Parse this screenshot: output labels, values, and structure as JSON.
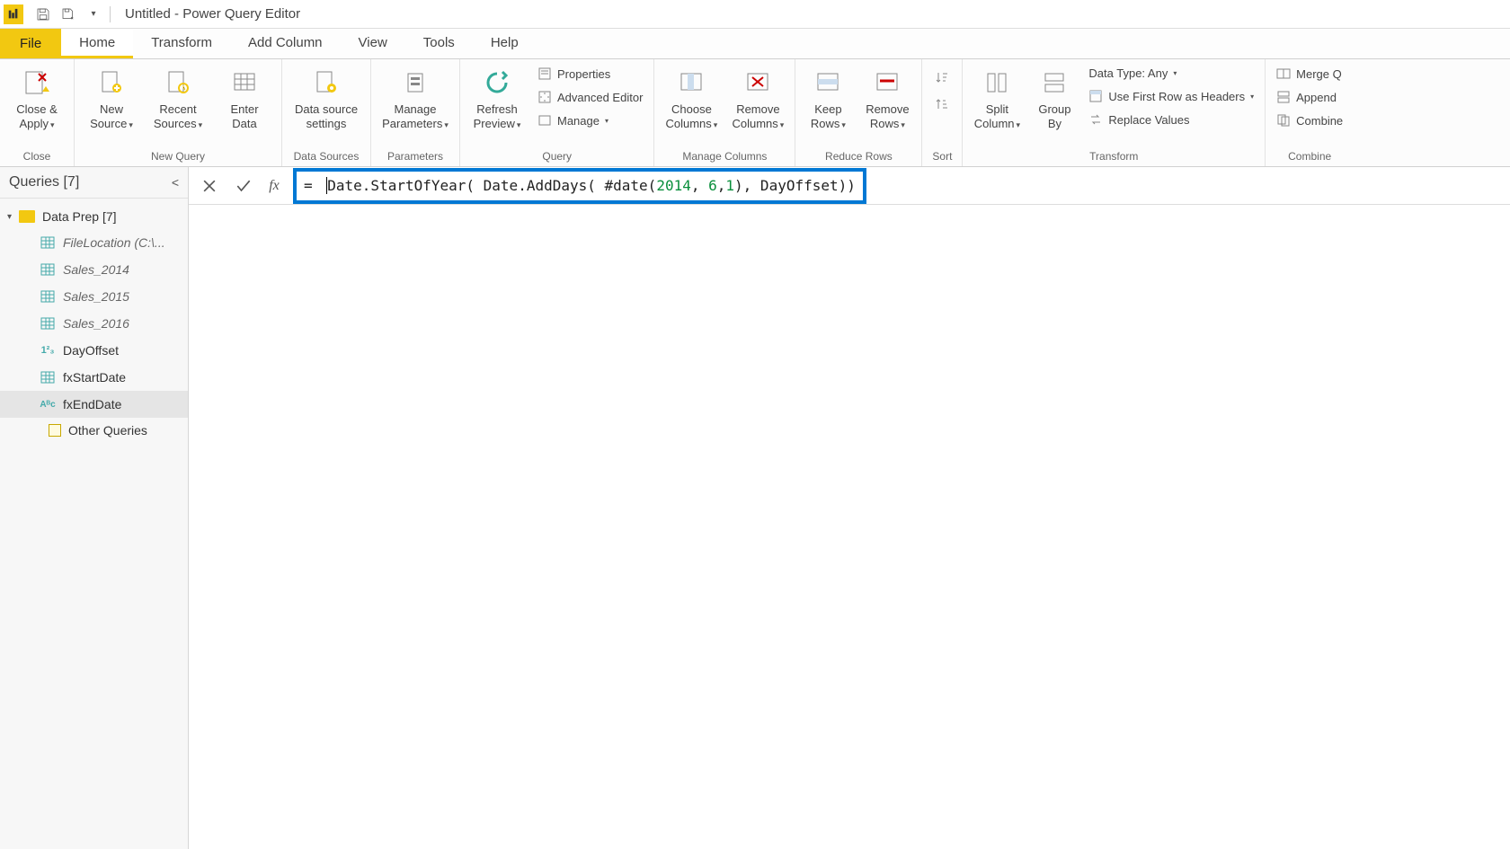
{
  "window": {
    "title": "Untitled - Power Query Editor"
  },
  "tabs": {
    "file": "File",
    "home": "Home",
    "transform": "Transform",
    "addColumn": "Add Column",
    "view": "View",
    "tools": "Tools",
    "help": "Help"
  },
  "ribbon": {
    "close": {
      "closeApply": "Close &\nApply",
      "group": "Close"
    },
    "newQuery": {
      "newSource": "New\nSource",
      "recentSources": "Recent\nSources",
      "enterData": "Enter\nData",
      "group": "New Query"
    },
    "dataSources": {
      "dataSourceSettings": "Data source\nsettings",
      "group": "Data Sources"
    },
    "parameters": {
      "manageParameters": "Manage\nParameters",
      "group": "Parameters"
    },
    "query": {
      "refreshPreview": "Refresh\nPreview",
      "properties": "Properties",
      "advancedEditor": "Advanced Editor",
      "manage": "Manage",
      "group": "Query"
    },
    "manageColumns": {
      "choose": "Choose\nColumns",
      "remove": "Remove\nColumns",
      "group": "Manage Columns"
    },
    "reduceRows": {
      "keep": "Keep\nRows",
      "remove": "Remove\nRows",
      "group": "Reduce Rows"
    },
    "sort": {
      "group": "Sort"
    },
    "transform": {
      "split": "Split\nColumn",
      "groupBy": "Group\nBy",
      "dataType": "Data Type: Any",
      "firstRowHeaders": "Use First Row as Headers",
      "replaceValues": "Replace Values",
      "group": "Transform"
    },
    "combine": {
      "merge": "Merge Q",
      "append": "Append",
      "combineF": "Combine",
      "group": "Combine"
    }
  },
  "queriesPane": {
    "header": "Queries [7]",
    "groups": [
      {
        "label": "Data Prep [7]",
        "items": [
          {
            "name": "FileLocation (C:\\...",
            "type": "table",
            "italic": true
          },
          {
            "name": "Sales_2014",
            "type": "table",
            "italic": true
          },
          {
            "name": "Sales_2015",
            "type": "table",
            "italic": true
          },
          {
            "name": "Sales_2016",
            "type": "table",
            "italic": true
          },
          {
            "name": "DayOffset",
            "type": "number",
            "italic": false
          },
          {
            "name": "fxStartDate",
            "type": "table",
            "italic": false
          },
          {
            "name": "fxEndDate",
            "type": "abc",
            "italic": false,
            "selected": true
          }
        ]
      },
      {
        "label": "Other Queries",
        "items": []
      }
    ]
  },
  "formulaBar": {
    "prefix": "= ",
    "seg1": "Date.StartOfYear( Date.AddDays( #date(",
    "n2014": "2014",
    "sep1": ", ",
    "n6": "6",
    "sep2": ",",
    "n1": "1",
    "seg2": "), DayOffset))"
  }
}
